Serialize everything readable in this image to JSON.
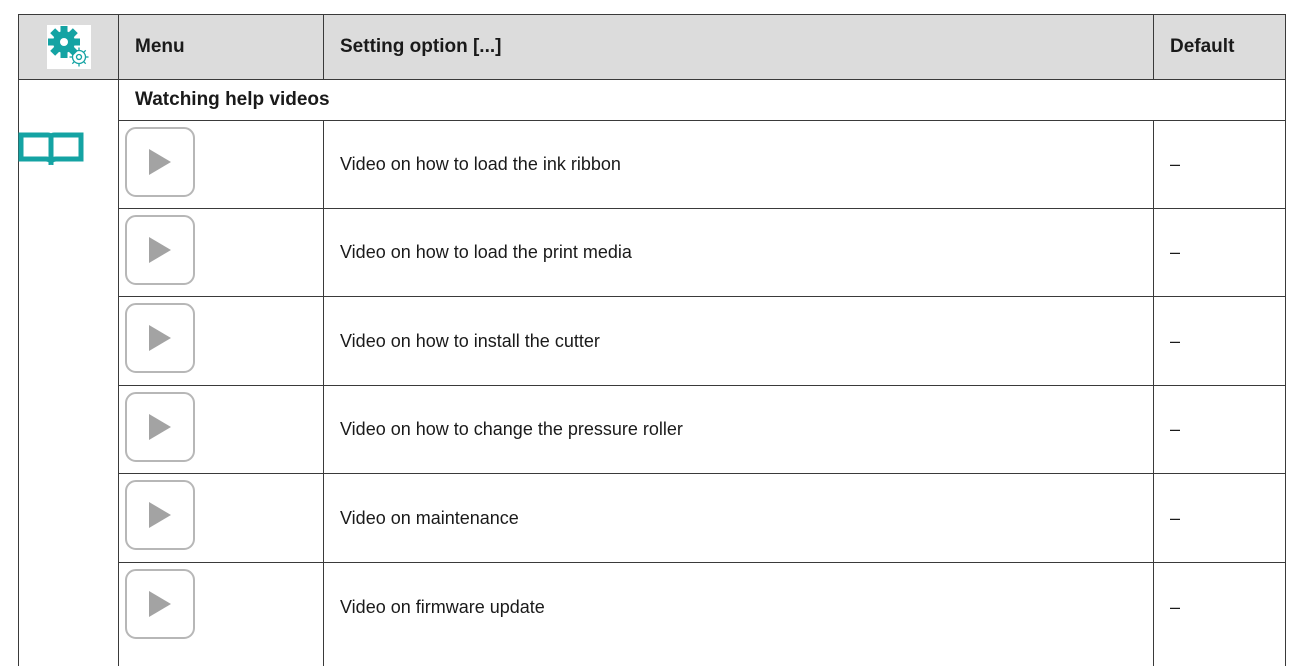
{
  "header": {
    "menu_label": "Menu",
    "setting_option_label": "Setting option  [...]",
    "default_label": "Default",
    "settings_icon": "gear-settings-icon"
  },
  "section": {
    "title": "Watching help videos",
    "icon": "book-icon"
  },
  "colors": {
    "header_bg": "#dcdcdc",
    "accent_teal": "#14a3a3",
    "play_border": "#b7b7b7",
    "play_triangle": "#a3a3a3",
    "border": "#3a3a3a"
  },
  "rows": [
    {
      "label": "Video on how to load the ink ribbon",
      "default": "–",
      "icon": "play-icon"
    },
    {
      "label": "Video on how to load the print media",
      "default": "–",
      "icon": "play-icon"
    },
    {
      "label": "Video on how to install the cutter",
      "default": "–",
      "icon": "play-icon"
    },
    {
      "label": "Video on how to change the pressure roller",
      "default": "–",
      "icon": "play-icon"
    },
    {
      "label": "Video on maintenance",
      "default": "–",
      "icon": "play-icon"
    },
    {
      "label": "Video on firmware update",
      "default": "–",
      "icon": "play-icon"
    }
  ]
}
